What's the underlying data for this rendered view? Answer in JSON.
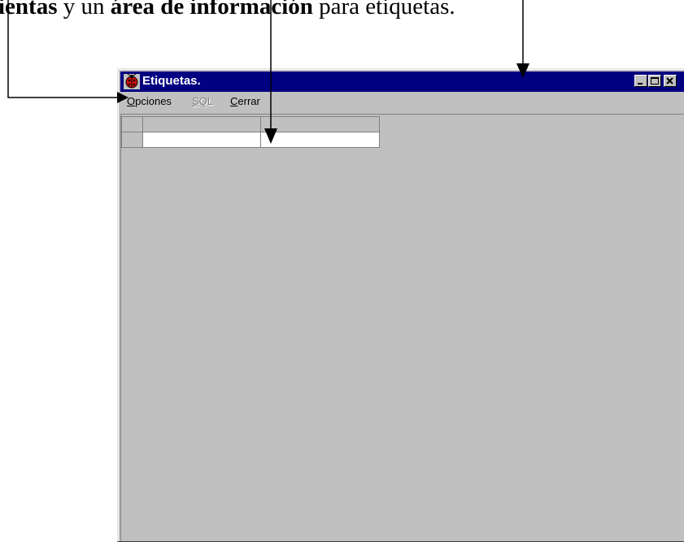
{
  "caption": {
    "part1": "ientas",
    "part2": " y un ",
    "part3": "área de información",
    "part4": " para etiquetas."
  },
  "window": {
    "title": "Etiquetas."
  },
  "menu": {
    "opciones": {
      "mnemonic": "O",
      "rest": "pciones"
    },
    "sql": {
      "mnemonic": "S",
      "rest": "QL"
    },
    "cerrar": {
      "mnemonic": "C",
      "rest": "errar"
    }
  },
  "colors": {
    "titlebar": "#000080",
    "window_face": "#c0c0c0",
    "disabled_text": "#808080"
  },
  "icons": {
    "app": "red-ladybug-icon",
    "minimize": "minimize-icon",
    "maximize": "maximize-icon",
    "close": "close-icon"
  }
}
